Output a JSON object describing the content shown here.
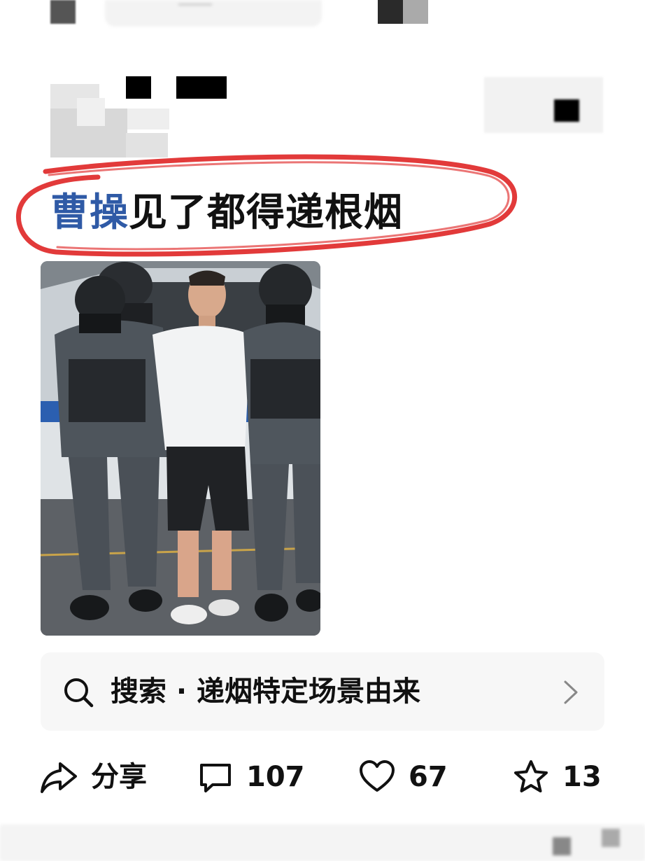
{
  "post": {
    "title_highlight": "曹操",
    "title_rest": "见了都得递根烟"
  },
  "search_suggestion": {
    "text": "搜索 · 递烟特定场景由来"
  },
  "actions": {
    "share_label": "分享",
    "comments_count": "107",
    "likes_count": "67",
    "favorites_count": "13"
  },
  "colors": {
    "title_highlight": "#2f5aa6",
    "annotation_circle": "#e23a3a",
    "search_bg": "#f7f7f7"
  },
  "icons": {
    "search": "search-icon",
    "chevron": "chevron-right-icon",
    "share": "share-arrow-icon",
    "comment": "comment-bubble-icon",
    "like": "heart-icon",
    "favorite": "star-icon"
  }
}
